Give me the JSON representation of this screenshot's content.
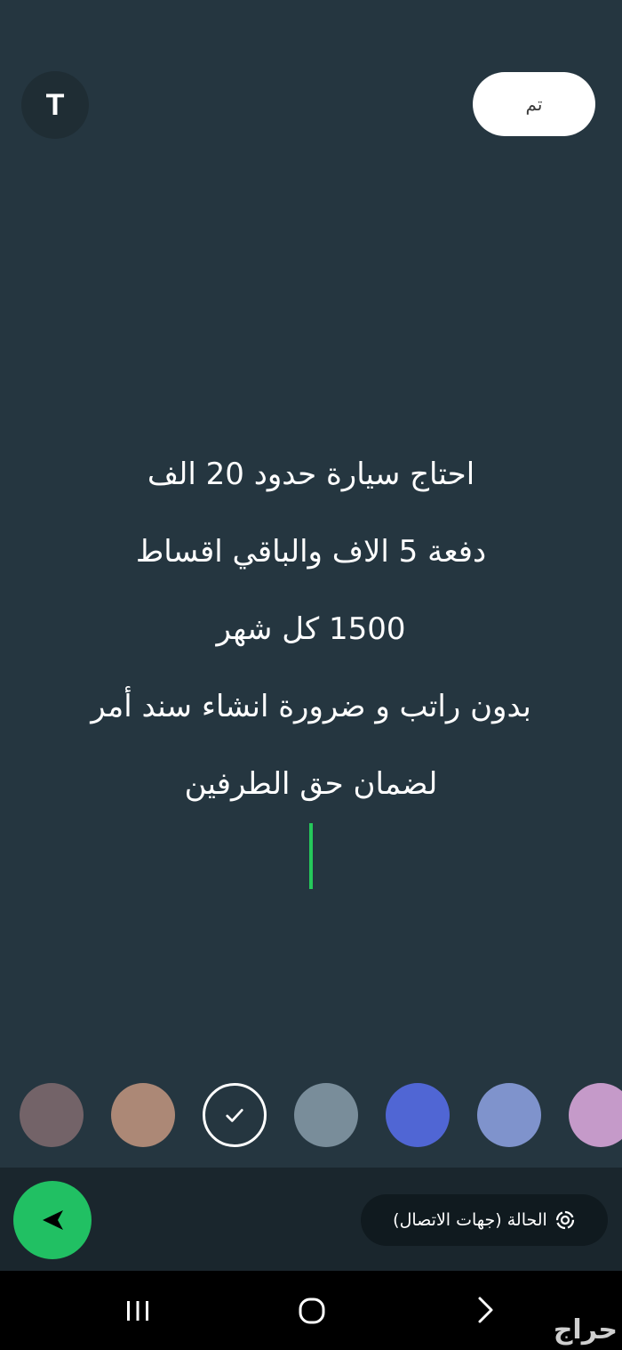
{
  "toolbar": {
    "font_button_label": "T",
    "done_label": "تم"
  },
  "status": {
    "lines": [
      "احتاج سيارة حدود 20 الف",
      "دفعة 5 الاف والباقي اقساط",
      "1500 كل شهر",
      "بدون راتب و ضرورة انشاء سند أمر",
      "لضمان حق الطرفين"
    ],
    "cursor_color": "#25c85a"
  },
  "palette": {
    "colors": [
      {
        "name": "mauve-gray",
        "hex": "#736368"
      },
      {
        "name": "tan",
        "hex": "#ac8876"
      },
      {
        "name": "dark-teal",
        "hex": "#253640",
        "selected": true
      },
      {
        "name": "slate-gray",
        "hex": "#798d9a"
      },
      {
        "name": "royal-blue",
        "hex": "#5066d4"
      },
      {
        "name": "periwinkle",
        "hex": "#7f93cc"
      },
      {
        "name": "orchid",
        "hex": "#c59ac9"
      }
    ]
  },
  "bottom": {
    "audience_label": "الحالة (جهات الاتصال)",
    "audience_icon": "status-ring-icon",
    "send_icon": "send-icon",
    "send_color": "#21c063"
  },
  "navbar": {
    "recents_icon": "recents-icon",
    "home_icon": "home-icon",
    "back_icon": "back-icon"
  },
  "watermark": {
    "text": "حراج"
  },
  "colors": {
    "background": "#253640",
    "bottom_bar": "#1a262d",
    "nav_bar": "#000000"
  }
}
